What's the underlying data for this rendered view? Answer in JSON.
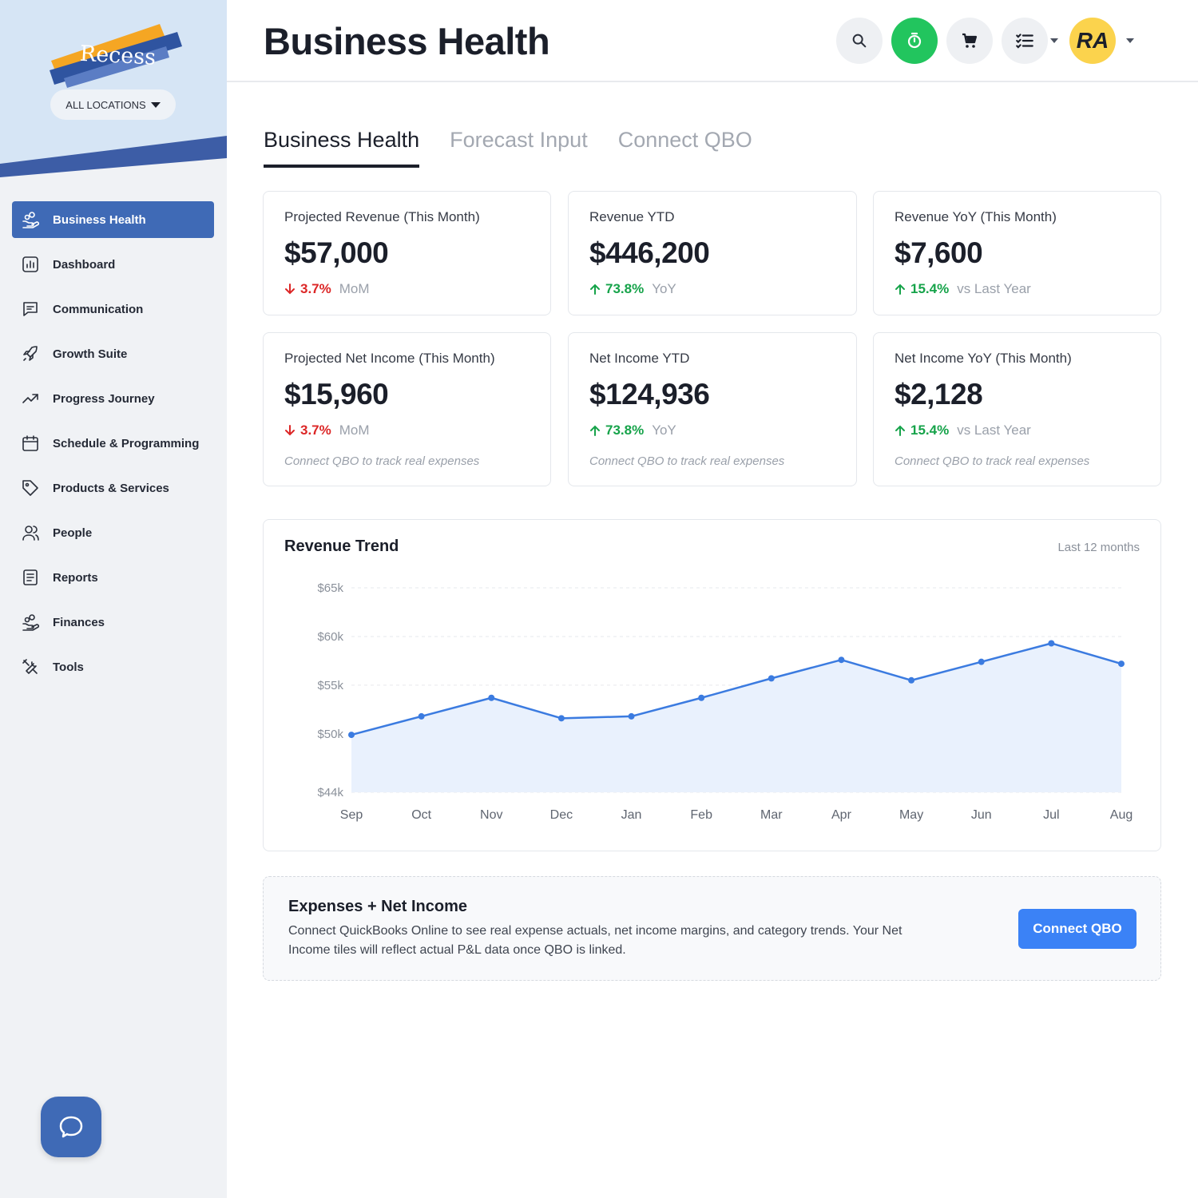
{
  "sidebar": {
    "logo_text": "Recess",
    "location_selector": "ALL LOCATIONS",
    "items": [
      {
        "label": "Business Health",
        "icon": "hand-coins-icon",
        "active": true
      },
      {
        "label": "Dashboard",
        "icon": "bar-chart-icon"
      },
      {
        "label": "Communication",
        "icon": "message-icon"
      },
      {
        "label": "Growth Suite",
        "icon": "rocket-icon"
      },
      {
        "label": "Progress Journey",
        "icon": "trend-up-icon"
      },
      {
        "label": "Schedule & Programming",
        "icon": "calendar-icon"
      },
      {
        "label": "Products & Services",
        "icon": "tag-icon"
      },
      {
        "label": "People",
        "icon": "people-icon"
      },
      {
        "label": "Reports",
        "icon": "report-icon"
      },
      {
        "label": "Finances",
        "icon": "hand-coins-icon"
      },
      {
        "label": "Tools",
        "icon": "tools-icon"
      }
    ],
    "chat_icon": "chat-bubble-icon"
  },
  "header": {
    "title": "Business Health",
    "avatar_initials": "RA",
    "buttons": [
      "search-icon",
      "timer-icon",
      "cart-icon",
      "checklist-icon"
    ]
  },
  "tabs": [
    {
      "label": "Business Health",
      "active": true
    },
    {
      "label": "Forecast Input",
      "active": false
    },
    {
      "label": "Connect QBO",
      "active": false
    }
  ],
  "cards": [
    {
      "label": "Projected Revenue (This Month)",
      "value": "$57,000",
      "direction": "down",
      "pct": "3.7%",
      "compare": "MoM",
      "note": ""
    },
    {
      "label": "Revenue YTD",
      "value": "$446,200",
      "direction": "up",
      "pct": "73.8%",
      "compare": "YoY",
      "note": ""
    },
    {
      "label": "Revenue YoY (This Month)",
      "value": "$7,600",
      "direction": "up",
      "pct": "15.4%",
      "compare": "vs Last Year",
      "note": ""
    },
    {
      "label": "Projected Net Income (This Month)",
      "value": "$15,960",
      "direction": "down",
      "pct": "3.7%",
      "compare": "MoM",
      "note": "Connect QBO to track real expenses"
    },
    {
      "label": "Net Income YTD",
      "value": "$124,936",
      "direction": "up",
      "pct": "73.8%",
      "compare": "YoY",
      "note": "Connect QBO to track real expenses"
    },
    {
      "label": "Net Income YoY (This Month)",
      "value": "$2,128",
      "direction": "up",
      "pct": "15.4%",
      "compare": "vs Last Year",
      "note": "Connect QBO to track real expenses"
    }
  ],
  "chart_data": {
    "type": "area",
    "title": "Revenue Trend",
    "subtitle": "Last 12 months",
    "categories": [
      "Sep",
      "Oct",
      "Nov",
      "Dec",
      "Jan",
      "Feb",
      "Mar",
      "Apr",
      "May",
      "Jun",
      "Jul",
      "Aug"
    ],
    "values": [
      49900,
      51800,
      53700,
      51600,
      51800,
      53700,
      55700,
      57600,
      55500,
      57400,
      59300,
      57200
    ],
    "yticks": [
      44000,
      50000,
      55000,
      60000,
      65000
    ],
    "ytick_labels": [
      "$44k",
      "$50k",
      "$55k",
      "$60k",
      "$65k"
    ],
    "ylim": [
      44000,
      65000
    ],
    "grid": true,
    "colors": {
      "line": "#3b7be0",
      "fill": "#e9f1fd"
    }
  },
  "banner": {
    "title": "Expenses + Net Income",
    "text": "Connect QuickBooks Online to see real expense actuals, net income margins, and category trends. Your Net Income tiles will reflect actual P&L data once QBO is linked.",
    "button": "Connect QBO"
  },
  "colors": {
    "sidebar_active": "#3f6ab6",
    "up": "#16a34a",
    "down": "#dc2626",
    "primary_button": "#3b82f6",
    "timer_button": "#22c55e",
    "avatar": "#fbd34d"
  }
}
